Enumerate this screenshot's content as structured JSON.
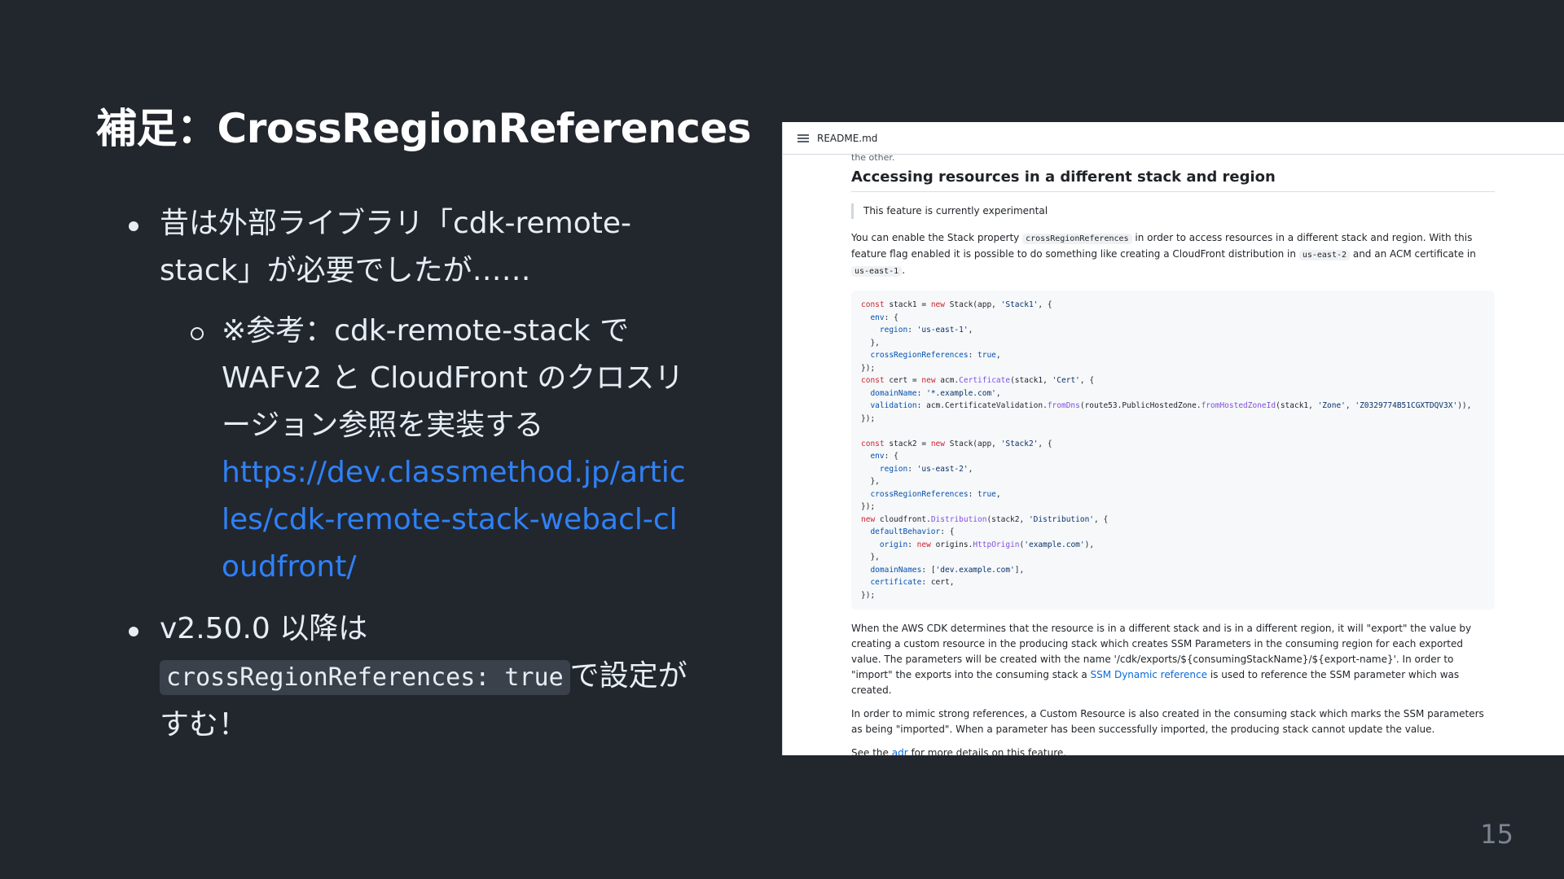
{
  "slide": {
    "title": "補足：CrossRegionReferences",
    "page_number": "15"
  },
  "bullets": {
    "b1_text": "昔は外部ライブラリ「cdk-remote-stack」が必要でしたが……",
    "b1_sub_text": "※参考：cdk-remote-stack で WAFv2 と CloudFront のクロスリージョン参照を実装する",
    "b1_sub_link": "https://dev.classmethod.jp/articles/cdk-remote-stack-webacl-cloudfront/",
    "b2_prefix": "v2.50.0 以降は",
    "b2_code": "crossRegionReferences: true",
    "b2_suffix": "で設定がすむ！"
  },
  "readme": {
    "filename": "README.md",
    "cut_text": "the other.",
    "heading": "Accessing resources in a different stack and region",
    "quote": "This feature is currently experimental",
    "p1_a": "You can enable the Stack property",
    "p1_code": "crossRegionReferences",
    "p1_b": "in order to access resources in a different stack and region. With this feature flag enabled it is possible to do something like creating a CloudFront distribution in",
    "p1_code2": "us-east-2",
    "p1_c": "and an ACM certificate in",
    "p1_code3": "us-east-1",
    "p1_d": ".",
    "p2_a": "When the AWS CDK determines that the resource is in a different stack and is in a different region, it will \"export\" the value by creating a custom resource in the producing stack which creates SSM Parameters in the consuming region for each exported value. The parameters will be created with the name '/cdk/exports/${consumingStackName}/${export-name}'. In order to \"import\" the exports into the consuming stack a",
    "p2_link": "SSM Dynamic reference",
    "p2_b": "is used to reference the SSM parameter which was created.",
    "p3": "In order to mimic strong references, a Custom Resource is also created in the consuming stack which marks the SSM parameters as being \"imported\". When a parameter has been successfully imported, the producing stack cannot update the value.",
    "p4_a": "See the",
    "p4_link": "adr",
    "p4_b": "for more details on this feature."
  }
}
